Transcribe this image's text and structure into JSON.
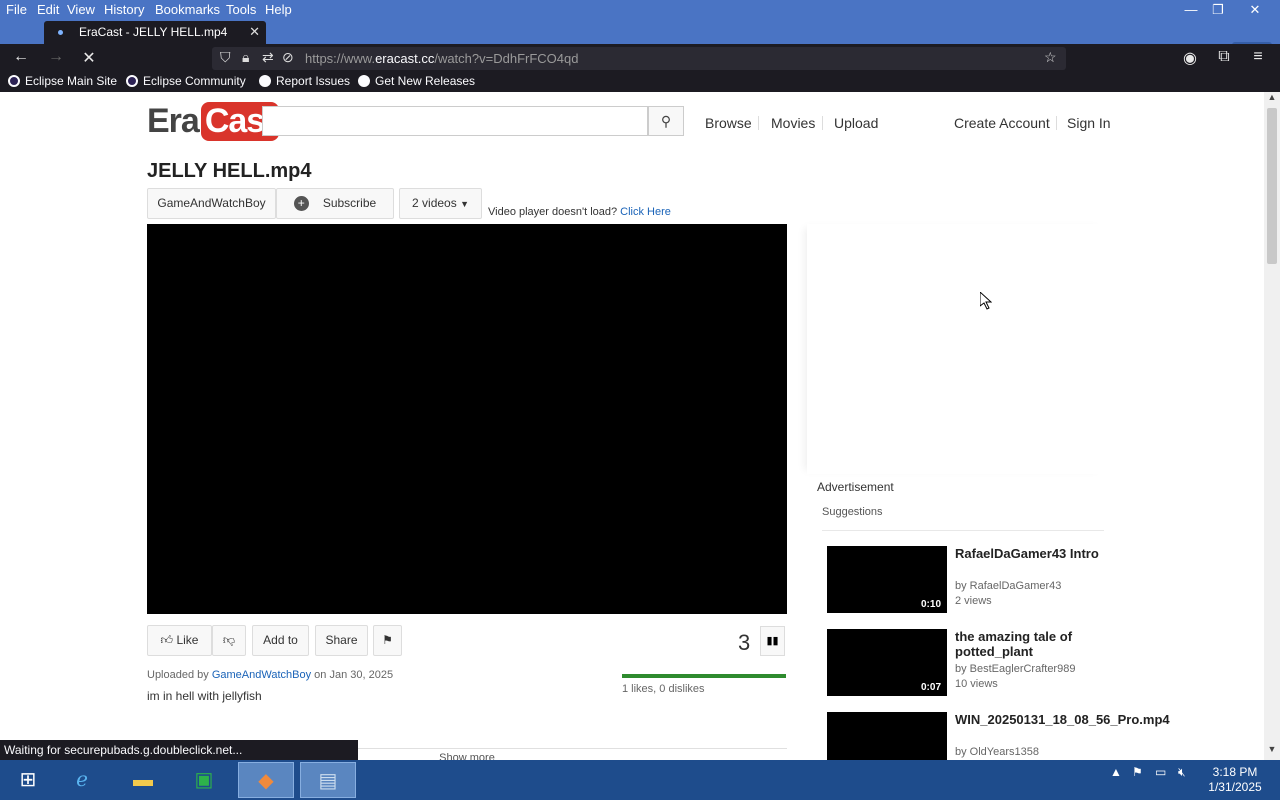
{
  "menubar": {
    "items": [
      "File",
      "Edit",
      "View",
      "History",
      "Bookmarks",
      "Tools",
      "Help"
    ]
  },
  "window": {
    "minimize": "—",
    "restore": "❐",
    "close": "✕",
    "tab_count": "1"
  },
  "tab": {
    "title": "EraCast - JELLY HELL.mp4",
    "close": "✕",
    "new": "+"
  },
  "nav": {
    "url_prefix": "https://www.",
    "url_domain": "eracast.cc",
    "url_path": "/watch?v=DdhFrFCO4qd"
  },
  "bookmarks": [
    "Eclipse Main Site",
    "Eclipse Community",
    "Report Issues",
    "Get New Releases"
  ],
  "site": {
    "logo_era": "Era",
    "logo_cast": "Cast",
    "search_placeholder": "",
    "nav": [
      "Browse",
      "Movies",
      "Upload"
    ],
    "account": [
      "Create Account",
      "Sign In"
    ]
  },
  "video": {
    "title": "JELLY HELL.mp4",
    "channel": "GameAndWatchBoy",
    "subscribe": "Subscribe",
    "videos_count": "2 videos",
    "player_note": "Video player doesn't load?",
    "player_link": "Click Here",
    "like": "Like",
    "add_to": "Add to",
    "share": "Share",
    "views": "3",
    "likes_text": "1 likes, 0 dislikes",
    "uploaded_prefix": "Uploaded by",
    "uploaded_user": "GameAndWatchBoy",
    "uploaded_date": "on Jan 30, 2025",
    "description": "im in hell with jellyfish",
    "show_more": "Show more",
    "like_ratio": 1.0
  },
  "sidebar": {
    "advertisement": "Advertisement",
    "suggestions_label": "Suggestions",
    "items": [
      {
        "title": "RafaelDaGamer43 Intro",
        "by": "by RafaelDaGamer43",
        "views": "2 views",
        "duration": "0:10"
      },
      {
        "title": "the amazing tale of potted_plant",
        "by": "by BestEaglerCrafter989",
        "views": "10 views",
        "duration": "0:07"
      },
      {
        "title": "WIN_20250131_18_08_56_Pro.mp4",
        "by": "by OldYears1358",
        "views": "",
        "duration": ""
      }
    ]
  },
  "status": "Waiting for securepubads.g.doubleclick.net...",
  "clock": {
    "time": "3:18 PM",
    "date": "1/31/2025"
  }
}
